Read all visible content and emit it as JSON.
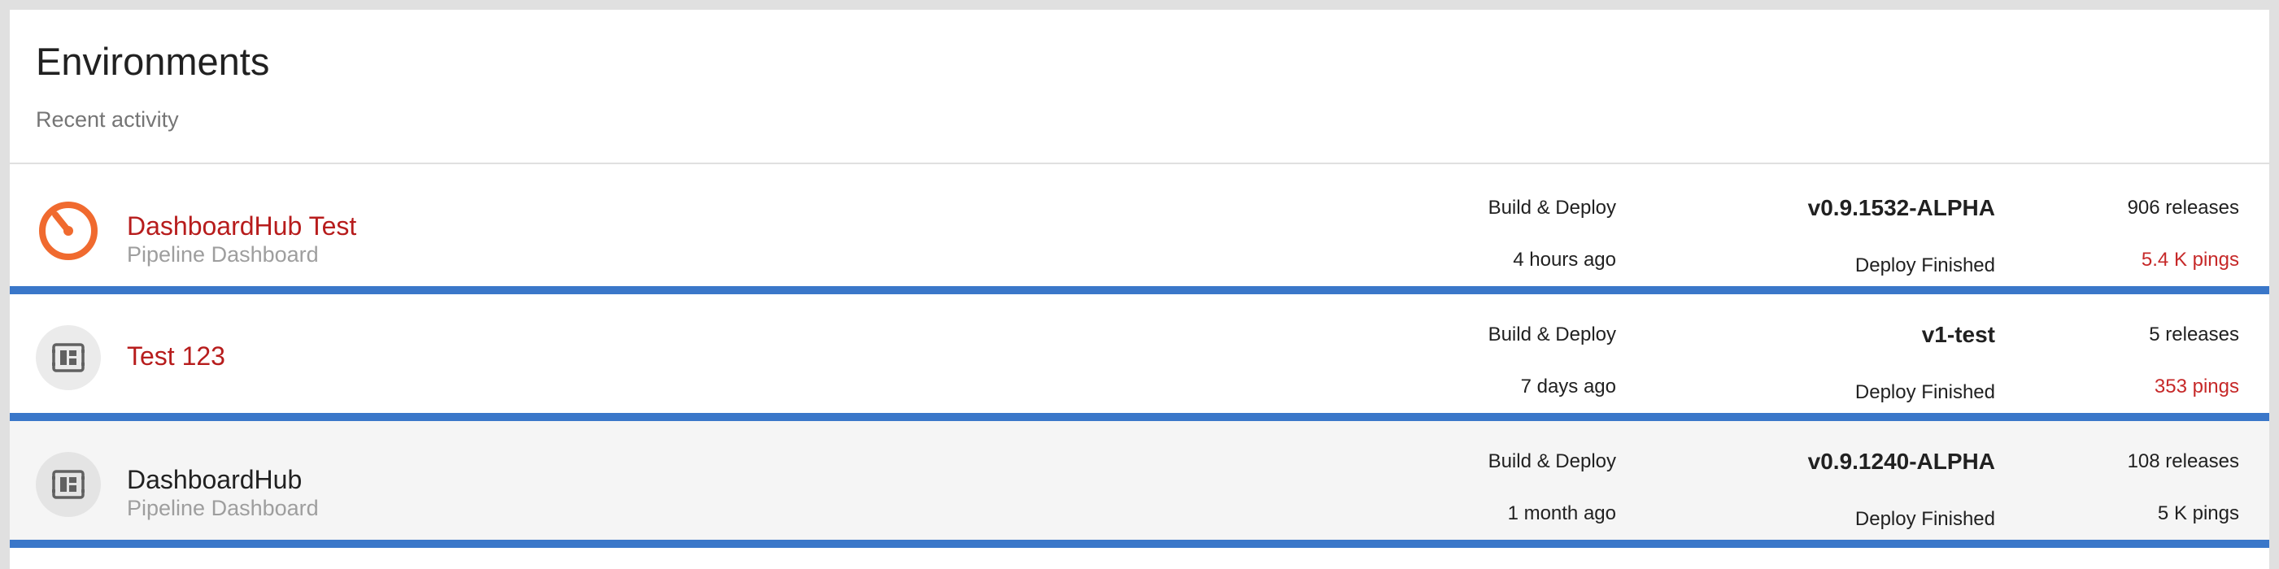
{
  "header": {
    "title": "Environments",
    "subtitle": "Recent activity"
  },
  "colors": {
    "accent_bar": "#3a77c9",
    "link_red": "#b71c1c",
    "dashboard_icon_orange": "#f06a2f"
  },
  "environments": [
    {
      "name": "DashboardHub Test",
      "description": "Pipeline Dashboard",
      "icon": "gauge-icon",
      "type": "Build & Deploy",
      "time": "4 hours ago",
      "version": "v0.9.1532-ALPHA",
      "status": "Deploy Finished",
      "releases": "906 releases",
      "pings": "5.4 K pings"
    },
    {
      "name": "Test 123",
      "description": "",
      "icon": "dashboard-widget-icon",
      "type": "Build & Deploy",
      "time": "7 days ago",
      "version": "v1-test",
      "status": "Deploy Finished",
      "releases": "5 releases",
      "pings": "353 pings"
    },
    {
      "name": "DashboardHub",
      "description": "Pipeline Dashboard",
      "icon": "dashboard-widget-icon",
      "type": "Build & Deploy",
      "time": "1 month ago",
      "version": "v0.9.1240-ALPHA",
      "status": "Deploy Finished",
      "releases": "108 releases",
      "pings": "5 K pings"
    }
  ]
}
